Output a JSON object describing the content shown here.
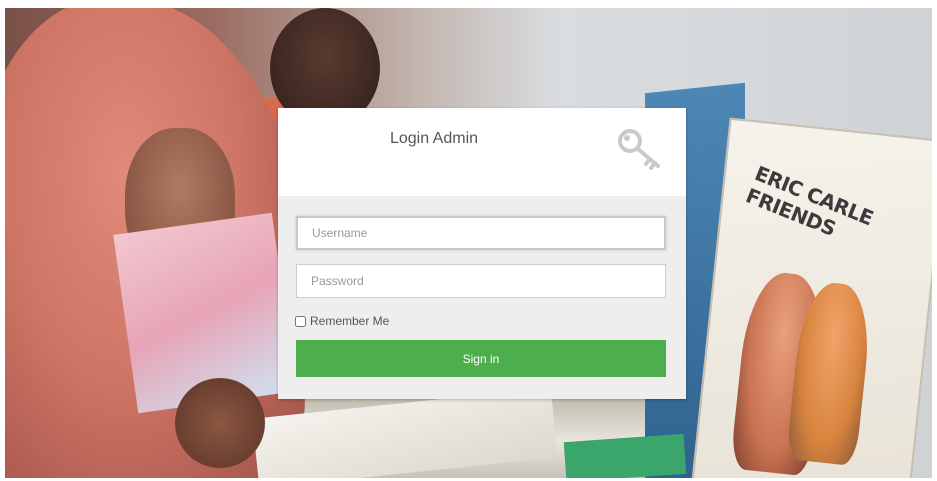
{
  "login": {
    "title": "Login Admin",
    "icon": "key-icon",
    "username_placeholder": "Username",
    "username_value": "",
    "password_placeholder": "Password",
    "password_value": "",
    "remember_label": "Remember Me",
    "remember_checked": false,
    "signin_label": "Sign in"
  },
  "background": {
    "book_title": "ERIC CARLE FRIENDS"
  },
  "colors": {
    "signin_button": "#4cae4c",
    "panel_body": "#eeeeee",
    "panel_header": "#ffffff"
  }
}
